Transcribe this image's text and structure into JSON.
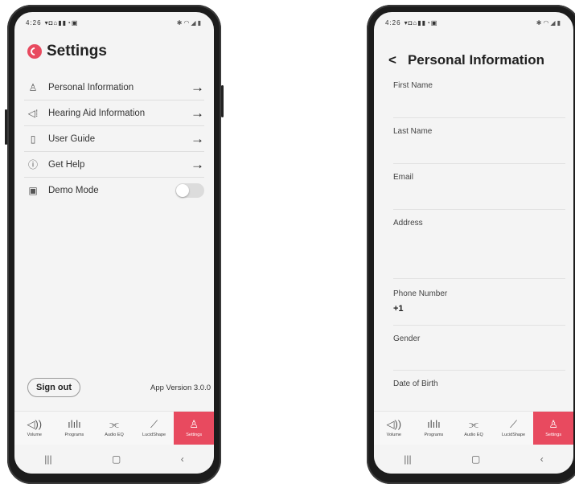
{
  "status_time": "4:26",
  "settings": {
    "title": "Settings",
    "menu": [
      {
        "label": "Personal Information",
        "icon": "person-icon"
      },
      {
        "label": "Hearing Aid Information",
        "icon": "hearing-aid-icon"
      },
      {
        "label": "User Guide",
        "icon": "book-icon"
      },
      {
        "label": "Get Help",
        "icon": "help-icon"
      }
    ],
    "demo_mode": {
      "label": "Demo Mode",
      "icon": "demo-icon",
      "enabled": false
    },
    "sign_out": "Sign out",
    "app_version": "App Version 3.0.0"
  },
  "tabs": [
    {
      "label": "Volume",
      "icon": "volume-icon"
    },
    {
      "label": "Programs",
      "icon": "programs-icon"
    },
    {
      "label": "Audio EQ",
      "icon": "equalizer-icon"
    },
    {
      "label": "LucidShape",
      "icon": "chart-icon"
    },
    {
      "label": "Settings",
      "icon": "person-icon",
      "active": true
    }
  ],
  "personal_info": {
    "title": "Personal Information",
    "fields": [
      {
        "label": "First Name",
        "value": ""
      },
      {
        "label": "Last Name",
        "value": ""
      },
      {
        "label": "Email",
        "value": ""
      },
      {
        "label": "Address",
        "value": ""
      },
      {
        "label": "Phone Number",
        "value": "+1"
      },
      {
        "label": "Gender",
        "value": ""
      },
      {
        "label": "Date of Birth",
        "value": ""
      }
    ]
  },
  "colors": {
    "accent": "#e84a5f",
    "screen_bg": "#f4f4f4",
    "phone_body": "#1c1c1c"
  }
}
